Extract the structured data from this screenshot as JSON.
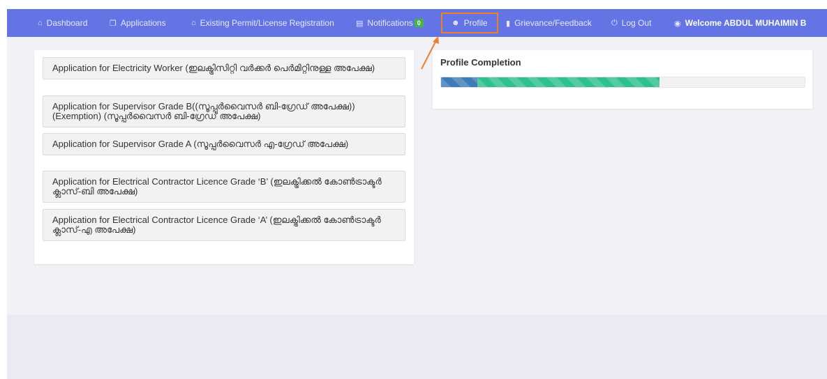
{
  "nav": {
    "items": [
      {
        "label": "Dashboard",
        "icon": "home-icon"
      },
      {
        "label": "Applications",
        "icon": "window-icon"
      },
      {
        "label": "Existing Permit/License Registration",
        "icon": "home-icon"
      },
      {
        "label": "Notifications",
        "icon": "list-icon",
        "badge": "0"
      },
      {
        "label": "Profile",
        "icon": "user-icon"
      },
      {
        "label": "Grievance/Feedback",
        "icon": "document-icon"
      },
      {
        "label": "Log Out",
        "icon": "power-icon"
      }
    ],
    "welcome": "Welcome ABDUL MUHAIMIN B",
    "welcome_icon": "user-circle-icon"
  },
  "applications": [
    {
      "label": "Application for Electricity Worker (ഇലക്ട്രിസിറ്റി വർക്കർ പെർമിറ്റിനുള്ള അപേക്ഷ)"
    },
    {
      "label": "Application for Supervisor Grade B((സൂപ്പർവൈസർ ബി-ഗ്രേഡ് അപേക്ഷ)) (Exemption) (സൂപ്പർവൈസർ ബി-ഗ്രേഡ് അപേക്ഷ)"
    },
    {
      "label": "Application for Supervisor Grade A (സൂപ്പർവൈസർ എ-ഗ്രേഡ് അപേക്ഷ)"
    },
    {
      "label": "Application for Electrical Contractor Licence Grade ‘B’ (ഇലക്ട്രിക്കൽ കോൺട്രാക്ടർ ക്ലാസ്-ബി അപേക്ഷ)"
    },
    {
      "label": "Application for Electrical Contractor Licence Grade ‘A’ (ഇലക്ട്രിക്കൽ കോൺട്രാക്ടർ ക്ലാസ്-എ അപേക്ഷ)"
    }
  ],
  "profile_completion": {
    "title": "Profile Completion",
    "segments": [
      {
        "color": "#3e7cb8",
        "fraction": 0.1
      },
      {
        "color": "#2fc08f",
        "fraction": 0.5
      }
    ]
  },
  "colors": {
    "navbar": "#6474e5",
    "highlight": "#ef7f2a",
    "badge": "#45b24a"
  }
}
